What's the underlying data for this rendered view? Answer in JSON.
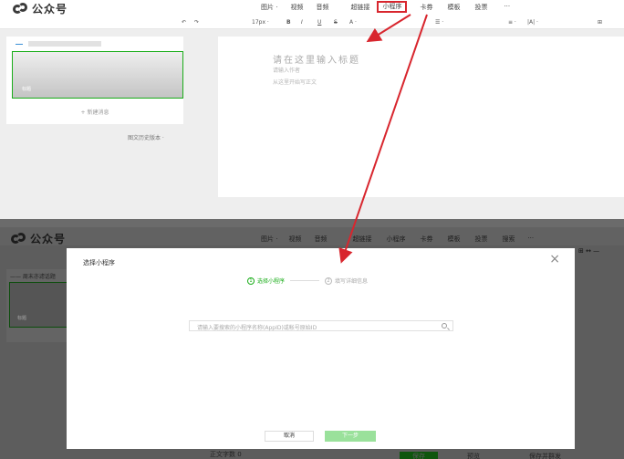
{
  "top": {
    "brand": "公众号",
    "menu": [
      "图片 ·",
      "视频",
      "音频",
      "超链接",
      "小程序",
      "卡券",
      "模板",
      "投票",
      "···"
    ],
    "toolbar": [
      "↶",
      "↷",
      "17px ·",
      "B",
      "I",
      "U",
      "S",
      "A ·",
      "☰ ·",
      "≡ ·",
      "|A| ·",
      "⊞"
    ],
    "panel": {
      "card_tag": "标题",
      "new_message": "+ 新建消息",
      "history": "图文历史版本 ·"
    },
    "editor": {
      "title_placeholder": "请在这里输入标题",
      "author_placeholder": "请输入作者",
      "body_placeholder": "从这里开始写正文"
    }
  },
  "bottom": {
    "brand": "公众号",
    "menu": [
      "图片 ·",
      "视频",
      "音频",
      "超链接",
      "小程序",
      "卡券",
      "模板",
      "投票",
      "搜索",
      "···"
    ],
    "panel": {
      "header": "—— 周末亦滤话题",
      "card_tag": "标题"
    },
    "right_icons": "⊞  ↔  —",
    "footer": {
      "text": "正文字数 0",
      "save": "保存",
      "preview": "预览",
      "publish": "保存并群发"
    },
    "dialog": {
      "title": "选择小程序",
      "close": "×",
      "steps": [
        {
          "num": "1",
          "label": "选择小程序"
        },
        {
          "num": "2",
          "label": "填写详细信息"
        }
      ],
      "search_placeholder": "请输入要搜索的小程序名称(AppID)或帐号原始ID",
      "cancel": "取消",
      "next": "下一步"
    }
  },
  "colors": {
    "accent_green": "#1aad19",
    "highlight_red": "#d8262e"
  }
}
